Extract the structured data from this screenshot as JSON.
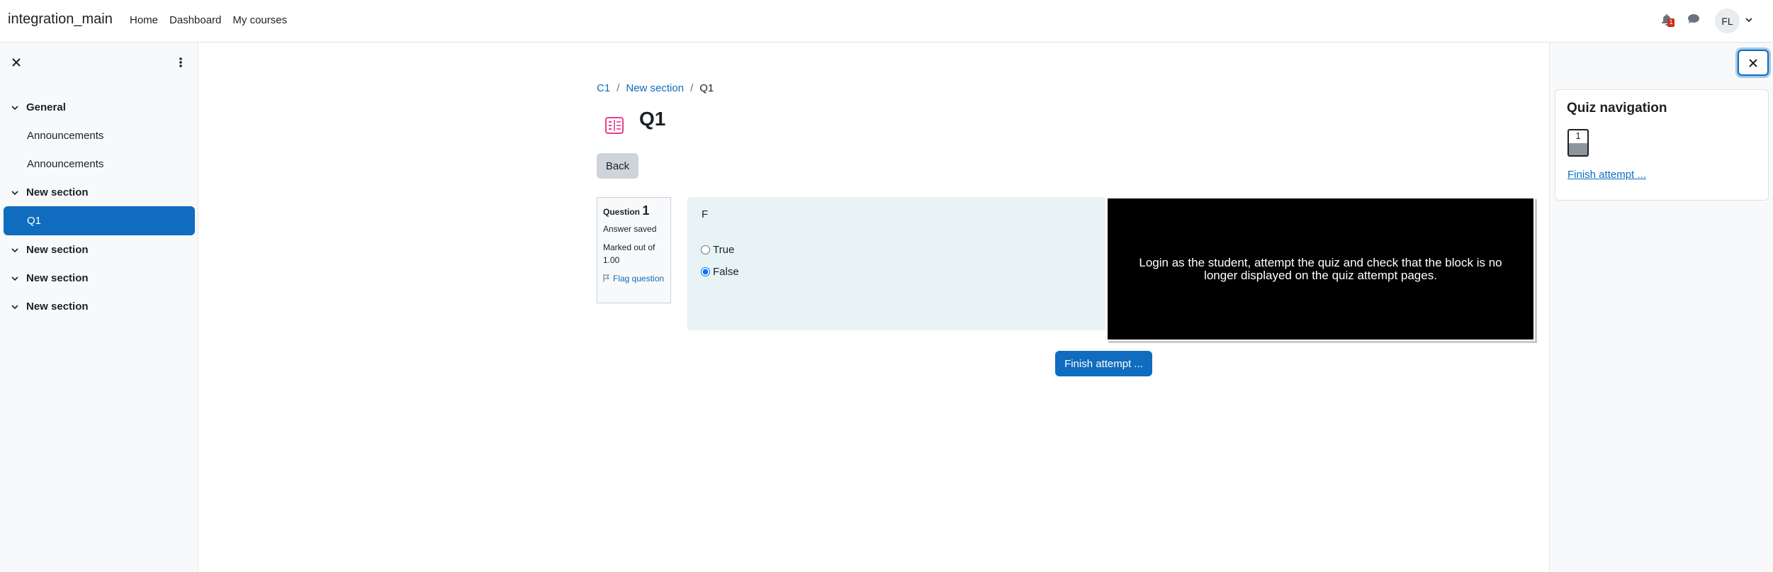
{
  "navbar": {
    "brand": "integration_main",
    "links": [
      "Home",
      "Dashboard",
      "My courses"
    ],
    "notifications_count": "1",
    "user_initials": "FL"
  },
  "course_index": {
    "sections": [
      {
        "title": "General",
        "items": [
          "Announcements",
          "Announcements"
        ]
      },
      {
        "title": "New section",
        "items": [
          "Q1"
        ]
      },
      {
        "title": "New section",
        "items": []
      },
      {
        "title": "New section",
        "items": []
      },
      {
        "title": "New section",
        "items": []
      }
    ],
    "active_item": "Q1"
  },
  "breadcrumb": {
    "items": [
      "C1",
      "New section",
      "Q1"
    ]
  },
  "page": {
    "title": "Q1",
    "back_label": "Back"
  },
  "question": {
    "label": "Question",
    "number": "1",
    "state": "Answer saved",
    "grade": "Marked out of 1.00",
    "flag_label": "Flag question",
    "text": "F",
    "options": [
      {
        "label": "True",
        "selected": false
      },
      {
        "label": "False",
        "selected": true
      }
    ]
  },
  "overlay_text": "Login as the student, attempt the quiz and check that the block is no longer displayed on the quiz attempt pages.",
  "finish_button": "Finish attempt ...",
  "quiz_nav": {
    "title": "Quiz navigation",
    "buttons": [
      {
        "number": "1",
        "answered": true
      }
    ],
    "finish_link": "Finish attempt ..."
  },
  "colors": {
    "primary": "#0f6cbf",
    "question_bg": "#e7f3f5",
    "badge": "#ca3120"
  }
}
